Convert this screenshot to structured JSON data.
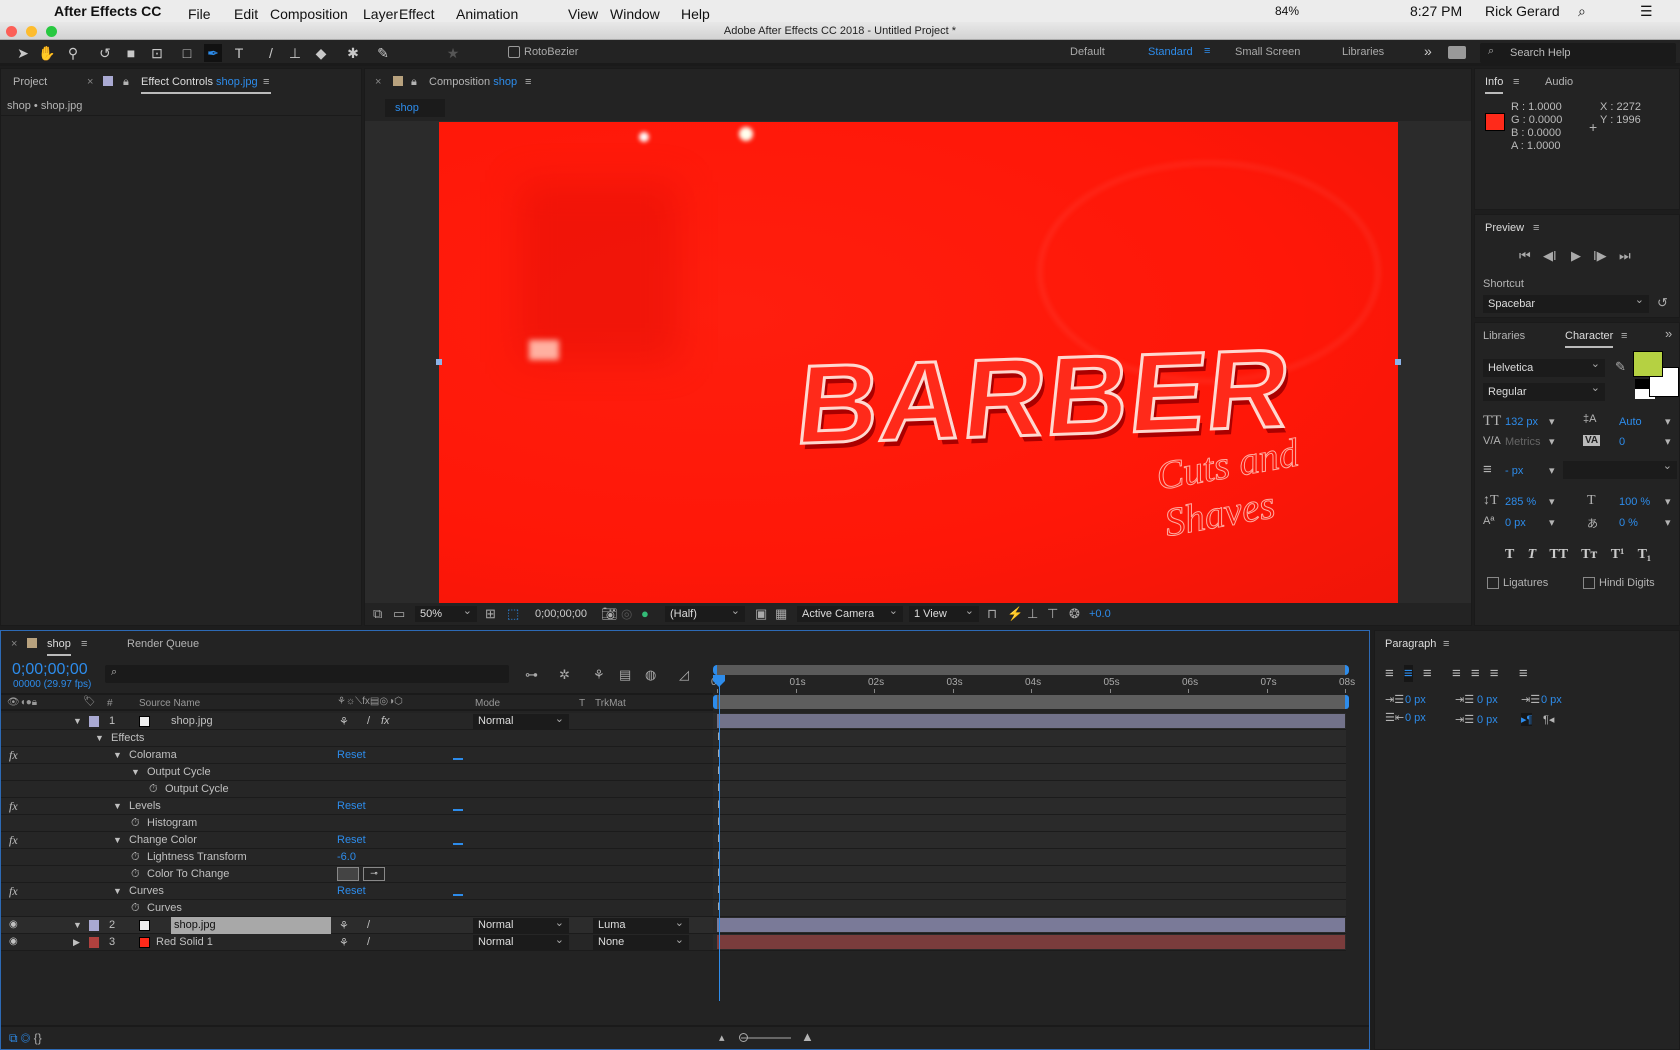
{
  "menubar": {
    "app": "After Effects CC",
    "items": [
      "File",
      "Edit",
      "Composition",
      "Layer",
      "Effect",
      "Animation",
      "View",
      "Window",
      "Help"
    ],
    "battery": "84%",
    "time": "8:27 PM",
    "user": "Rick Gerard"
  },
  "window": {
    "title": "Adobe After Effects CC 2018 - Untitled Project *"
  },
  "toolbar": {
    "rotobezier": "RotoBezier",
    "workspaces": [
      "Default",
      "Standard",
      "Small Screen",
      "Libraries"
    ],
    "active_workspace": "Standard",
    "search_placeholder": "Search Help"
  },
  "left_panel": {
    "tab_project": "Project",
    "tab_effect_controls": "Effect Controls",
    "effect_controls_target": "shop.jpg",
    "breadcrumb": "shop • shop.jpg"
  },
  "comp_panel": {
    "tab_label": "Composition",
    "comp_name": "shop",
    "subtab": "shop",
    "image_text": "BARBER",
    "zoom": "50%",
    "timecode": "0;00;00;00",
    "resolution": "(Half)",
    "camera": "Active Camera",
    "views": "1 View",
    "exposure": "+0.0"
  },
  "info": {
    "tab": "Info",
    "tab2": "Audio",
    "r": "R :  1.0000",
    "g": "G :  0.0000",
    "b": "B :  0.0000",
    "a": "A :  1.0000",
    "x": "X :  2272",
    "y": "Y :  1996",
    "swatch": "#ff2a1a"
  },
  "preview": {
    "title": "Preview",
    "shortcut_label": "Shortcut",
    "shortcut_value": "Spacebar"
  },
  "character": {
    "tab_libraries": "Libraries",
    "tab": "Character",
    "font": "Helvetica",
    "style": "Regular",
    "size": "132 px",
    "leading": "Auto",
    "kerning": "Metrics",
    "tracking": "0",
    "stroke": "- px",
    "vscale": "285 %",
    "hscale": "100 %",
    "baseline": "0 px",
    "tsume": "0 %",
    "ligatures": "Ligatures",
    "hindi": "Hindi Digits",
    "fill_color": "#b5d142"
  },
  "paragraph": {
    "title": "Paragraph",
    "indent_left": "0 px",
    "space_before": "0 px",
    "indent_first": "0 px",
    "indent_right": "0 px",
    "space_after": "0 px"
  },
  "timeline": {
    "tab": "shop",
    "tab2": "Render Queue",
    "timecode": "0;00;00;00",
    "frames": "00000 (29.97 fps)",
    "col_num": "#",
    "col_source": "Source Name",
    "col_mode": "Mode",
    "col_t": "T",
    "col_trkmat": "TrkMat",
    "ruler": [
      "0s",
      "01s",
      "02s",
      "03s",
      "04s",
      "05s",
      "06s",
      "07s",
      "08s"
    ],
    "rows": [
      {
        "type": "layer",
        "num": "1",
        "name": "shop.jpg",
        "mode": "Normal",
        "label": "#a9a9d2",
        "bar": "#72728a"
      },
      {
        "type": "prop",
        "indent": 1,
        "name": "Effects"
      },
      {
        "type": "effect",
        "indent": 2,
        "name": "Colorama",
        "value": "Reset"
      },
      {
        "type": "prop",
        "indent": 3,
        "name": "Output Cycle"
      },
      {
        "type": "stopwatch",
        "indent": 4,
        "name": "Output Cycle"
      },
      {
        "type": "effect",
        "indent": 2,
        "name": "Levels",
        "value": "Reset"
      },
      {
        "type": "stopwatch",
        "indent": 3,
        "name": "Histogram"
      },
      {
        "type": "effect",
        "indent": 2,
        "name": "Change Color",
        "value": "Reset"
      },
      {
        "type": "stopwatch",
        "indent": 3,
        "name": "Lightness Transform",
        "value": "-6.0"
      },
      {
        "type": "stopwatch",
        "indent": 3,
        "name": "Color To Change",
        "swatch": true
      },
      {
        "type": "effect",
        "indent": 2,
        "name": "Curves",
        "value": "Reset"
      },
      {
        "type": "stopwatch",
        "indent": 3,
        "name": "Curves"
      },
      {
        "type": "layer",
        "num": "2",
        "name": "shop.jpg",
        "mode": "Normal",
        "trkmat": "Luma",
        "label": "#a9a9d2",
        "bar": "#7a7a98",
        "selected": true
      },
      {
        "type": "layer",
        "num": "3",
        "name": "Red Solid 1",
        "mode": "Normal",
        "trkmat": "None",
        "label": "#b0413e",
        "bar": "#7a3c3c",
        "solid": true
      }
    ]
  }
}
